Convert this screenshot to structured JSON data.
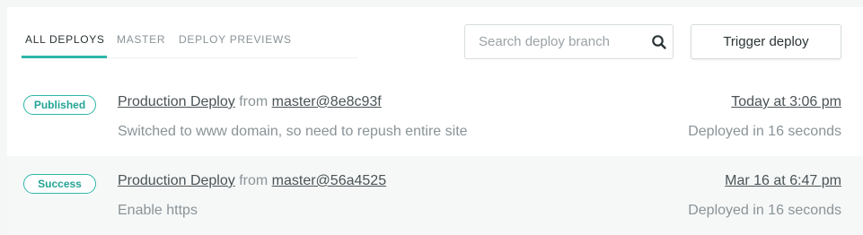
{
  "tabs": [
    {
      "label": "All deploys",
      "active": true
    },
    {
      "label": "Master"
    },
    {
      "label": "Deploy previews"
    }
  ],
  "search": {
    "placeholder": "Search deploy branch",
    "icon": "search-icon"
  },
  "trigger_button": {
    "label": "Trigger deploy"
  },
  "deploys": [
    {
      "status": "Published",
      "title": "Production Deploy",
      "from_text": "from",
      "ref": "master@8e8c93f",
      "time": "Today at 3:06 pm",
      "message": "Switched to www domain, so need to repush entire site",
      "duration": "Deployed in 16 seconds"
    },
    {
      "status": "Success",
      "title": "Production Deploy",
      "from_text": "from",
      "ref": "master@56a4525",
      "time": "Mar 16 at 6:47 pm",
      "message": "Enable https",
      "duration": "Deployed in 16 seconds"
    }
  ],
  "colors": {
    "accent": "#2db7a8",
    "text": "#2b3437",
    "muted": "#8a9397"
  }
}
